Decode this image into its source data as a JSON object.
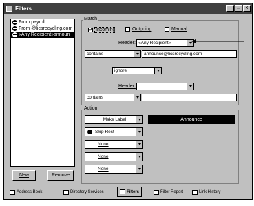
{
  "window": {
    "title": "Filters",
    "min": "_",
    "max": "□",
    "close": "x"
  },
  "filters": [
    {
      "label": "From payroll",
      "selected": false
    },
    {
      "label": "From @licsrecycling.com",
      "selected": false
    },
    {
      "label": "«Any Recipient»announ",
      "selected": true
    }
  ],
  "buttons": {
    "new": "New",
    "remove": "Remove"
  },
  "match": {
    "group_label": "Match",
    "incoming": "Incoming",
    "incoming_checked": true,
    "outgoing": "Outgoing",
    "outgoing_checked": false,
    "manual": "Manual",
    "manual_checked": false,
    "header1_label": "Header:",
    "header1_value": "«Any Recipient»",
    "condition1": "contains",
    "value1": "announce@licsrecycling.com",
    "conjunction": "ignore",
    "header2_label": "Header:",
    "header2_value": "",
    "condition2": "contains",
    "value2": ""
  },
  "action": {
    "group_label": "Action",
    "items": [
      {
        "label": "Make Label"
      },
      {
        "label": "Skip Rest"
      },
      {
        "label": "None"
      },
      {
        "label": "None"
      },
      {
        "label": "None"
      }
    ],
    "label_value": "Announce"
  },
  "tabs": [
    {
      "label": "Address Book"
    },
    {
      "label": "Directory Services"
    },
    {
      "label": "Filters"
    },
    {
      "label": "Filter Report"
    },
    {
      "label": "Link History"
    }
  ]
}
